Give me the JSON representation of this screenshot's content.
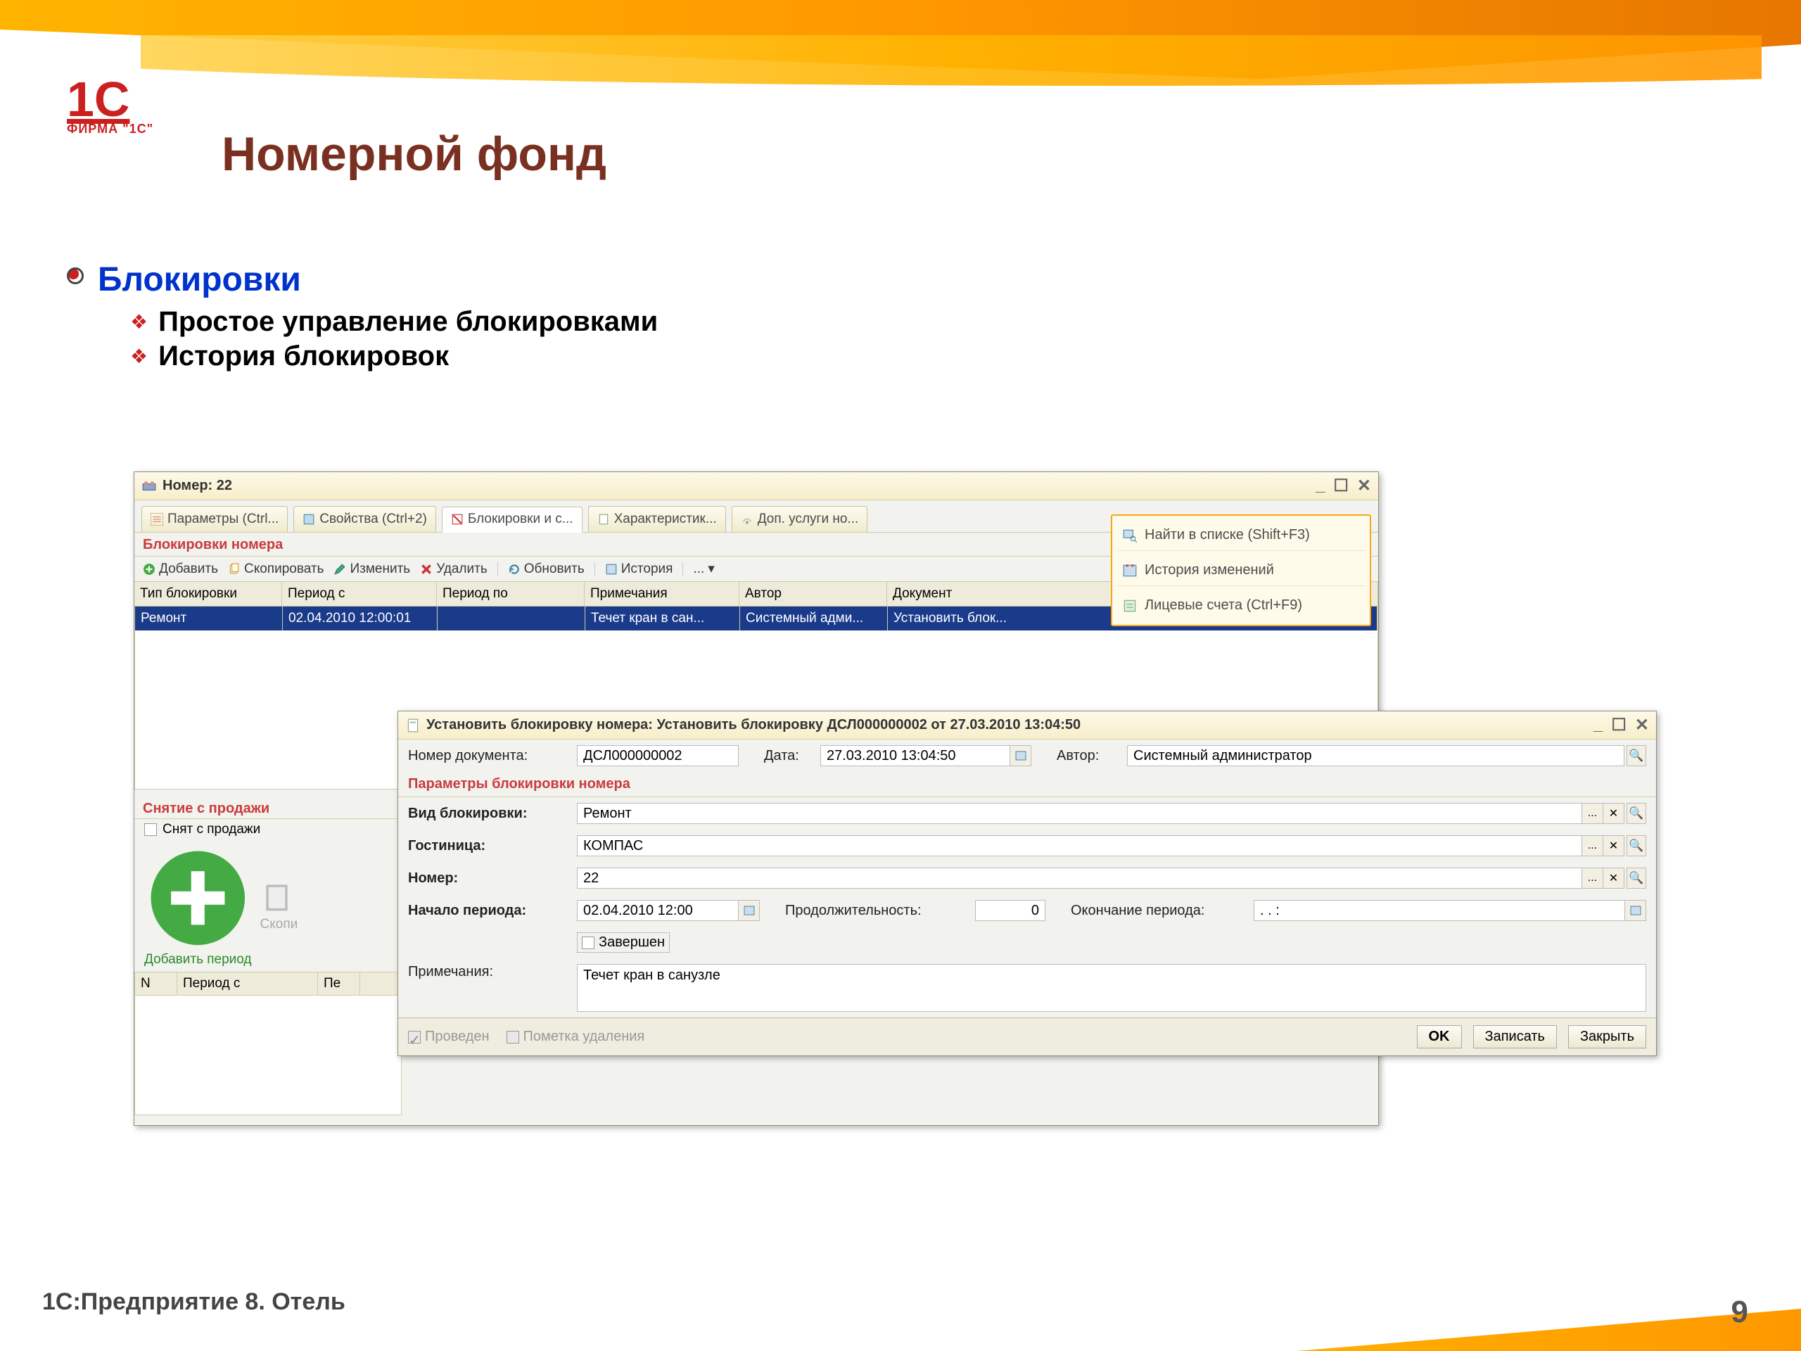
{
  "slide": {
    "logoMain": "1С",
    "logoSub": "ФИРМА \"1С\"",
    "title": "Номерной фонд",
    "bullet1": "Блокировки",
    "bullet2a": "Простое управление блокировками",
    "bullet2b": "История блокировок",
    "footerLeft": "1С:Предприятие 8. Отель",
    "pageNum": "9"
  },
  "win1": {
    "title": "Номер: 22",
    "tabs": {
      "t1": "Параметры (Ctrl...",
      "t2": "Свойства (Ctrl+2)",
      "t3": "Блокировки и с...",
      "t4": "Характеристик...",
      "t5": "Доп. услуги но..."
    },
    "sub": "Блокировки номера",
    "toolbar": {
      "add": "Добавить",
      "copy": "Скопировать",
      "edit": "Изменить",
      "del": "Удалить",
      "refresh": "Обновить",
      "hist": "История",
      "more": "..."
    },
    "cols": {
      "c1": "Тип блокировки",
      "c2": "Период с",
      "c3": "Период по",
      "c4": "Примечания",
      "c5": "Автор",
      "c6": "Документ"
    },
    "row": {
      "c1": "Ремонт",
      "c2": "02.04.2010 12:00:01",
      "c3": "",
      "c4": "Течет кран в сан...",
      "c5": "Системный адми...",
      "c6": "Установить блок..."
    },
    "side": {
      "a1": "Найти в списке (Shift+F3)",
      "a2": "История изменений",
      "a3": "Лицевые счета (Ctrl+F9)"
    },
    "sub2": "Снятие с продажи",
    "off": "Снят с продажи",
    "st": {
      "add": "Добавить период",
      "copy": "Скопи"
    },
    "scols": {
      "n": "N",
      "c1": "Период с",
      "c2": "Пе"
    }
  },
  "win2": {
    "title": "Установить блокировку номера: Установить блокировку ДСЛ000000002 от 27.03.2010 13:04:50",
    "docnum_l": "Номер документа:",
    "docnum": "ДСЛ000000002",
    "date_l": "Дата:",
    "date": "27.03.2010 13:04:50",
    "author_l": "Автор:",
    "author": "Системный администратор",
    "section": "Параметры блокировки номера",
    "type_l": "Вид блокировки:",
    "type": "Ремонт",
    "hotel_l": "Гостиница:",
    "hotel": "КОМПАС",
    "room_l": "Номер:",
    "room": "22",
    "start_l": "Начало периода:",
    "start": "02.04.2010 12:00",
    "dur_l": "Продолжительность:",
    "dur": "0",
    "end_l": "Окончание периода:",
    "end": "  .  .    :",
    "done": "Завершен",
    "notes_l": "Примечания:",
    "notes": "Течет кран в санузле",
    "posted": "Проведен",
    "delmark": "Пометка удаления",
    "ok": "OK",
    "save": "Записать",
    "close": "Закрыть"
  }
}
